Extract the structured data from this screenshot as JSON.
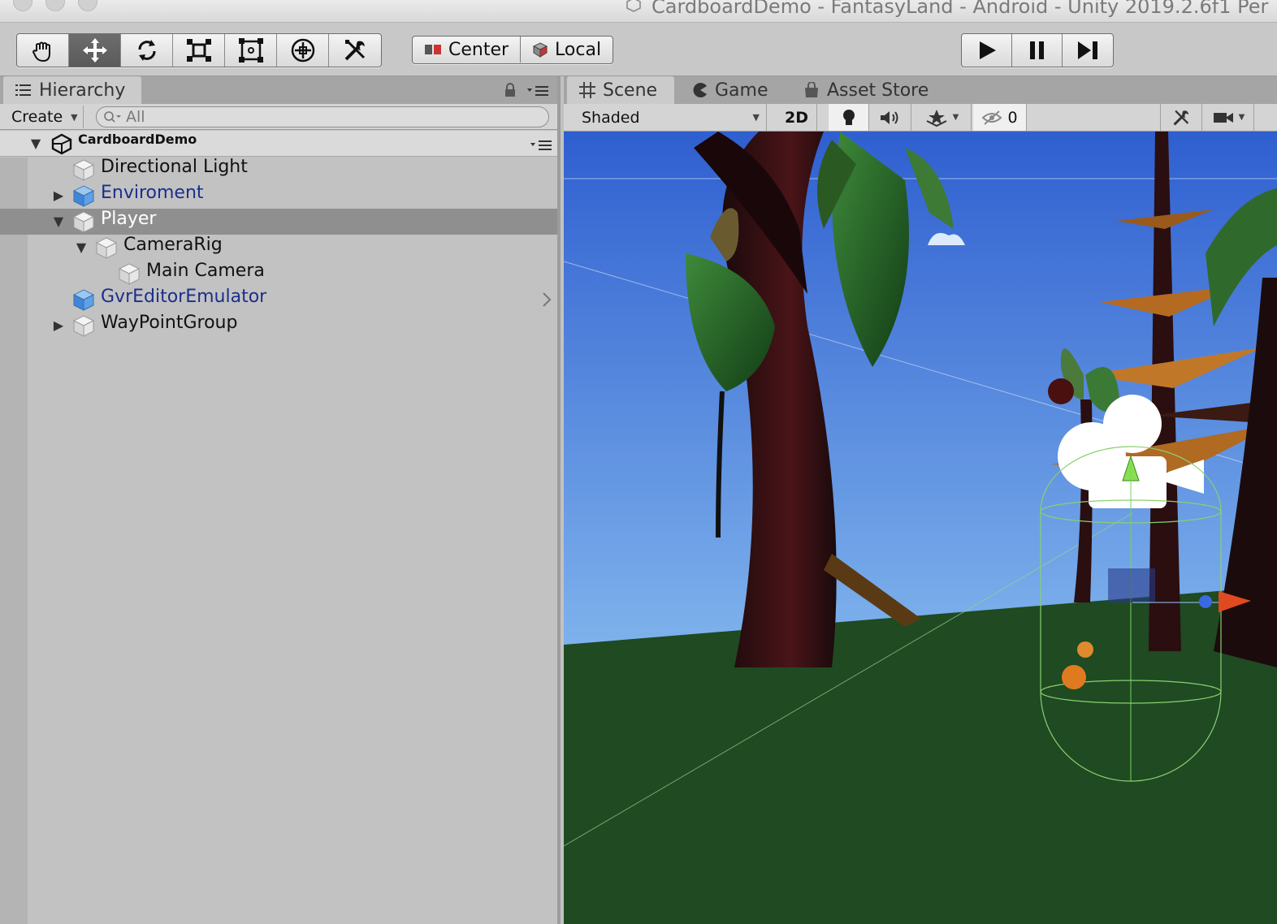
{
  "window": {
    "title": "CardboardDemo - FantasyLand - Android - Unity 2019.2.6f1 Per"
  },
  "toolbar": {
    "transform_tools": [
      {
        "name": "hand-tool",
        "icon": "hand-icon"
      },
      {
        "name": "move-tool",
        "icon": "move-icon",
        "active": true
      },
      {
        "name": "rotate-tool",
        "icon": "rotate-icon"
      },
      {
        "name": "scale-tool",
        "icon": "scale-icon"
      },
      {
        "name": "rect-tool",
        "icon": "rect-icon"
      },
      {
        "name": "transform-tool",
        "icon": "transform-icon"
      },
      {
        "name": "custom-tool",
        "icon": "tools-icon"
      }
    ],
    "pivot_label": "Center",
    "space_label": "Local",
    "play_icon": "play-icon",
    "pause_icon": "pause-icon",
    "step_icon": "step-icon"
  },
  "hierarchy": {
    "tab_label": "Hierarchy",
    "create_label": "Create",
    "search_placeholder": "All",
    "scene_name": "CardboardDemo",
    "items": [
      {
        "label": "Directional Light",
        "depth": 1,
        "expand": "none",
        "prefab": false,
        "selected": false
      },
      {
        "label": "Enviroment",
        "depth": 1,
        "expand": "collapsed",
        "prefab": true,
        "selected": false
      },
      {
        "label": "Player",
        "depth": 1,
        "expand": "expanded",
        "prefab": false,
        "selected": true
      },
      {
        "label": "CameraRig",
        "depth": 2,
        "expand": "expanded",
        "prefab": false,
        "selected": false
      },
      {
        "label": "Main Camera",
        "depth": 3,
        "expand": "none",
        "prefab": false,
        "selected": false
      },
      {
        "label": "GvrEditorEmulator",
        "depth": 1,
        "expand": "none",
        "prefab": true,
        "selected": false,
        "has_child_arrow": true
      },
      {
        "label": "WayPointGroup",
        "depth": 1,
        "expand": "collapsed",
        "prefab": false,
        "selected": false
      }
    ]
  },
  "scene": {
    "tabs": [
      {
        "label": "Scene",
        "icon": "grid-icon",
        "active": true
      },
      {
        "label": "Game",
        "icon": "pacman-icon",
        "active": false
      },
      {
        "label": "Asset Store",
        "icon": "store-icon",
        "active": false
      }
    ],
    "shading_mode": "Shaded",
    "mode_2d_label": "2D",
    "hidden_count": "0"
  },
  "colors": {
    "sky_top": "#2f5fd0",
    "sky_bottom": "#7fb3ec",
    "ground": "#1f4a22",
    "prefab_text": "#1b2f8a",
    "selection": "#8f8f8f"
  }
}
